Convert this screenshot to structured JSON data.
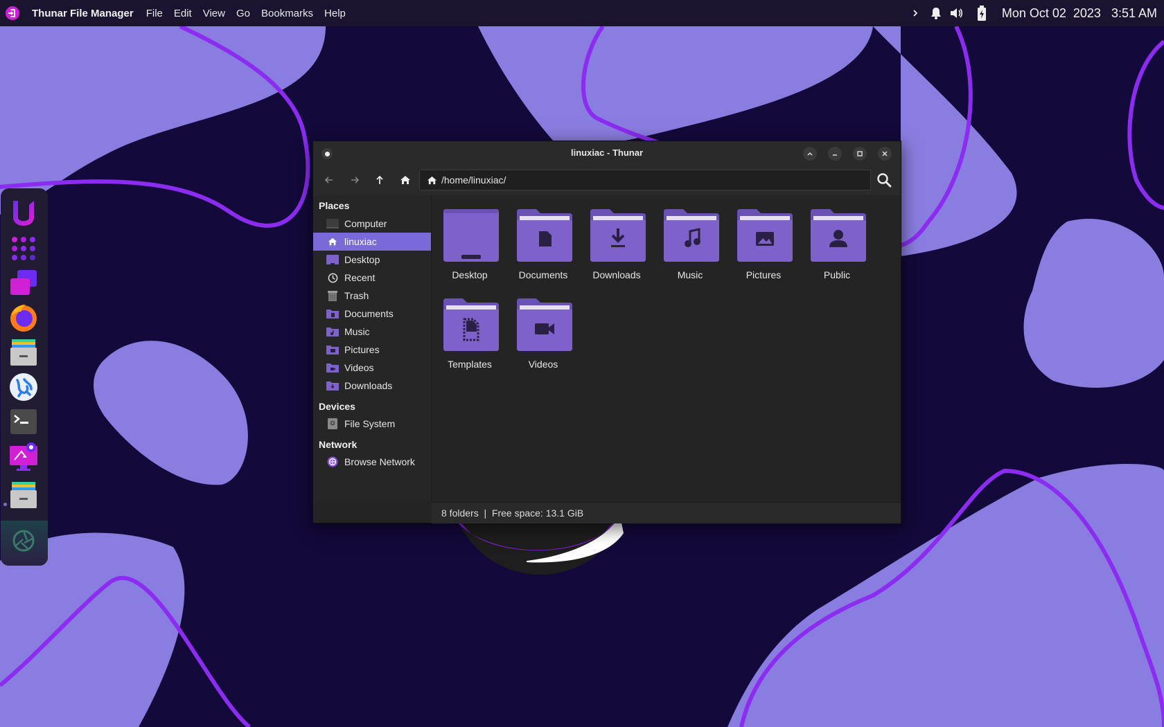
{
  "panel": {
    "app_name": "Thunar File Manager",
    "menus": [
      "File",
      "Edit",
      "View",
      "Go",
      "Bookmarks",
      "Help"
    ],
    "tray_icons": [
      "chevron-right-icon",
      "bell-icon",
      "volume-icon",
      "battery-charging-icon"
    ],
    "clock": "Mon Oct 02  2023   3:51 AM"
  },
  "dock": {
    "apps": [
      "ulauncher",
      "app-grid",
      "workspaces",
      "firefox",
      "file-manager",
      "dialect",
      "terminal",
      "settings",
      "file-manager-running",
      "screenshot"
    ]
  },
  "window": {
    "title": "linuxiac - Thunar",
    "path": "/home/linuxiac/",
    "sidebar": {
      "places_header": "Places",
      "places": [
        {
          "label": "Computer",
          "icon": "computer-icon"
        },
        {
          "label": "linuxiac",
          "icon": "home-icon",
          "active": true
        },
        {
          "label": "Desktop",
          "icon": "desktop-folder-icon"
        },
        {
          "label": "Recent",
          "icon": "clock-icon"
        },
        {
          "label": "Trash",
          "icon": "trash-icon"
        },
        {
          "label": "Documents",
          "icon": "documents-folder-icon"
        },
        {
          "label": "Music",
          "icon": "music-folder-icon"
        },
        {
          "label": "Pictures",
          "icon": "pictures-folder-icon"
        },
        {
          "label": "Videos",
          "icon": "videos-folder-icon"
        },
        {
          "label": "Downloads",
          "icon": "downloads-folder-icon"
        }
      ],
      "devices_header": "Devices",
      "devices": [
        {
          "label": "File System",
          "icon": "drive-icon"
        }
      ],
      "network_header": "Network",
      "network": [
        {
          "label": "Browse Network",
          "icon": "network-icon"
        }
      ]
    },
    "folders": [
      {
        "label": "Desktop",
        "icon": "desktop-folder-icon"
      },
      {
        "label": "Documents",
        "icon": "documents-folder-icon"
      },
      {
        "label": "Downloads",
        "icon": "downloads-folder-icon"
      },
      {
        "label": "Music",
        "icon": "music-folder-icon"
      },
      {
        "label": "Pictures",
        "icon": "pictures-folder-icon"
      },
      {
        "label": "Public",
        "icon": "public-folder-icon"
      },
      {
        "label": "Templates",
        "icon": "templates-folder-icon"
      },
      {
        "label": "Videos",
        "icon": "videos-folder-icon"
      }
    ],
    "status": "8 folders  |  Free space: 13.1 GiB"
  },
  "colors": {
    "accent": "#7a6ad8",
    "folder": "#7d62c9",
    "wallpaper_dark": "#13093a",
    "wallpaper_blob": "#8a7de0",
    "wallpaper_line": "#8b2cf0"
  }
}
